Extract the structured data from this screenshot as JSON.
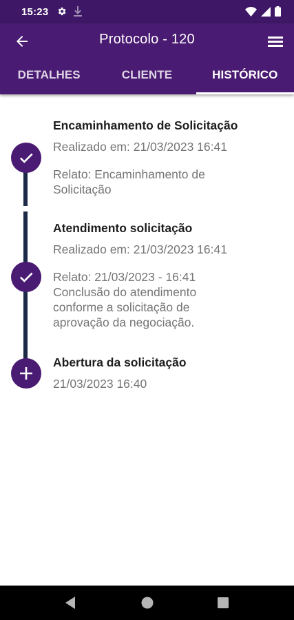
{
  "status_bar": {
    "time": "15:23",
    "icons": [
      "gear-icon",
      "download-icon",
      "wifi-icon",
      "signal-icon",
      "battery-icon"
    ]
  },
  "app_bar": {
    "title": "Protocolo - 120",
    "back_icon": "arrow-left-icon",
    "menu_icon": "hamburger-menu-icon",
    "background": "#4a1b72"
  },
  "tabs": [
    {
      "label": "DETALHES",
      "active": false
    },
    {
      "label": "CLIENTE",
      "active": false
    },
    {
      "label": "HISTÓRICO",
      "active": true
    }
  ],
  "history": [
    {
      "title": "Encaminhamento de Solicitação",
      "date": "Realizado em: 21/03/2023 16:41",
      "report": "Relato: Encaminhamento de\nSolicitação",
      "icon": "check-icon"
    },
    {
      "title": "Atendimento solicitação",
      "date": "Realizado em: 21/03/2023 16:41",
      "report": "Relato:  21/03/2023 - 16:41\nConclusão do atendimento\nconforme a solicitação de\naprovação da negociação.",
      "icon": "check-icon"
    },
    {
      "title": "Abertura da solicitação",
      "date": "21/03/2023 16:40",
      "icon": "plus-icon"
    }
  ],
  "colors": {
    "status_bar": "#3e1866",
    "accent": "#4a1b72",
    "timeline_line": "#1c2a48",
    "secondary_text": "#757575"
  },
  "nav_bar": {
    "icons": [
      "back-triangle-icon",
      "home-circle-icon",
      "recents-square-icon"
    ]
  }
}
